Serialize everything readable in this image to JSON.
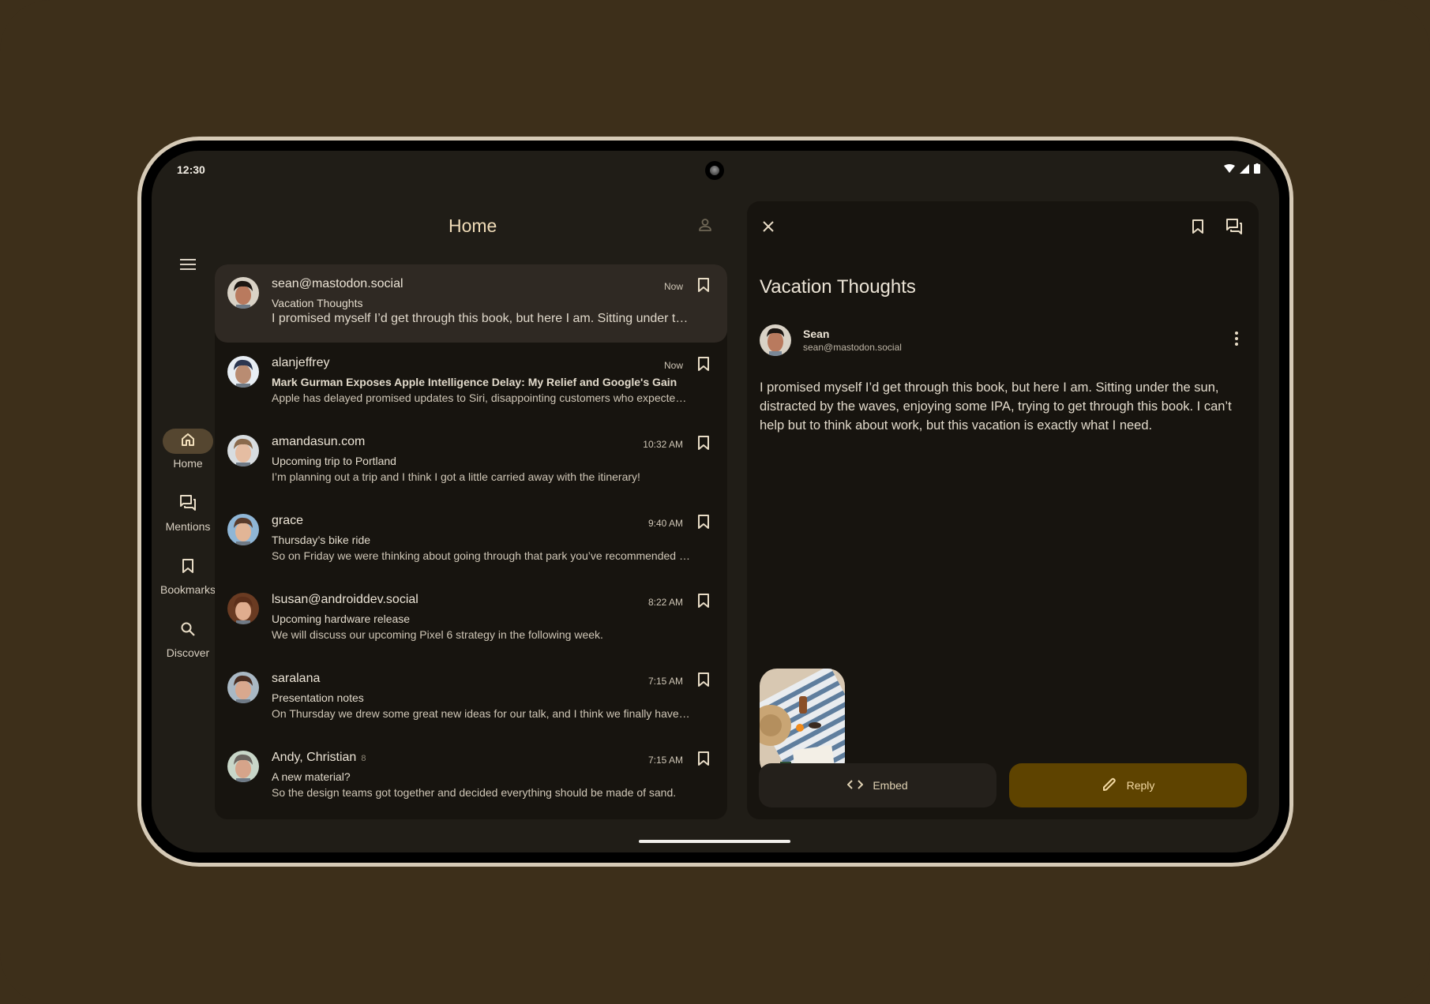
{
  "status_bar": {
    "time": "12:30",
    "icons": [
      "wifi-icon",
      "cellular-signal-icon",
      "battery-icon"
    ]
  },
  "nav_rail": {
    "menu_icon": "hamburger-menu-icon",
    "items": [
      {
        "label": "Home",
        "icon": "home-icon",
        "active": true
      },
      {
        "label": "Mentions",
        "icon": "chat-bubbles-icon",
        "active": false
      },
      {
        "label": "Bookmarks",
        "icon": "bookmark-icon",
        "active": false
      },
      {
        "label": "Discover",
        "icon": "search-icon",
        "active": false
      }
    ]
  },
  "list_header": {
    "title": "Home",
    "profile_icon": "person-icon"
  },
  "email_list": [
    {
      "sender": "sean@mastodon.social",
      "count": "",
      "time": "Now",
      "subject": "Vacation Thoughts",
      "preview": "I promised myself I’d get through this book, but here I am. Sitting under the sun, distracted by the waves, enjoying some IPA...",
      "selected": true,
      "bold_subject": false,
      "avatar_colors": [
        "#d9d2c6",
        "#1c1612",
        "#b97a5e"
      ]
    },
    {
      "sender": "alanjeffrey",
      "count": "",
      "time": "Now",
      "subject": "Mark Gurman Exposes Apple Intelligence Delay: My Relief and Google's Gain",
      "preview": "Apple has delayed promised updates to Siri, disappointing customers who expected them sooner.",
      "selected": false,
      "bold_subject": true,
      "avatar_colors": [
        "#e8eef4",
        "#2b3650",
        "#b98c72"
      ]
    },
    {
      "sender": "amandasun.com",
      "count": "",
      "time": "10:32 AM",
      "subject": "Upcoming trip to Portland",
      "preview": "I’m planning out a trip and I think I got a little carried away with the itinerary!",
      "selected": false,
      "bold_subject": false,
      "avatar_colors": [
        "#d8dde0",
        "#8a6a4c",
        "#e5bda2"
      ]
    },
    {
      "sender": "grace",
      "count": "",
      "time": "9:40 AM",
      "subject": "Thursday’s bike ride",
      "preview": "So on Friday we were thinking about going through that park you’ve recommended before.",
      "selected": false,
      "bold_subject": false,
      "avatar_colors": [
        "#8fb6d6",
        "#5a3b2a",
        "#e2b596"
      ]
    },
    {
      "sender": "lsusan@androiddev.social",
      "count": "",
      "time": "8:22 AM",
      "subject": "Upcoming hardware release",
      "preview": "We will discuss our upcoming Pixel 6 strategy in the following week.",
      "selected": false,
      "bold_subject": false,
      "avatar_colors": [
        "#6a3b22",
        "#5c2f1a",
        "#e0ad8e"
      ]
    },
    {
      "sender": "saralana",
      "count": "",
      "time": "7:15 AM",
      "subject": "Presentation notes",
      "preview": "On Thursday we drew some great new ideas for our talk, and I think we finally have it.",
      "selected": false,
      "bold_subject": false,
      "avatar_colors": [
        "#a9b8c4",
        "#4a2e22",
        "#d9a88e"
      ]
    },
    {
      "sender": "Andy, Christian",
      "count": "8",
      "time": "7:15 AM",
      "subject": "A new material?",
      "preview": "So the design teams got together and decided everything should be made of sand.",
      "selected": false,
      "bold_subject": false,
      "avatar_colors": [
        "#c8d6c8",
        "#6b6560",
        "#d6a48a"
      ]
    }
  ],
  "detail": {
    "close_icon": "close-icon",
    "bookmark_icon": "bookmark-icon",
    "reply_all_icon": "chat-bubbles-icon",
    "title": "Vacation Thoughts",
    "sender_name": "Sean",
    "sender_email": "sean@mastodon.social",
    "more_icon": "more-vert-icon",
    "body": "I promised myself I’d get through this book, but here I am. Sitting under the sun, distracted by the waves, enjoying some IPA, trying to get through this book. I can’t help but to think about work, but this vacation is exactly what I need.",
    "attachment_alt": "Beach towel with hat, book and drink on sand",
    "embed_label": "Embed",
    "reply_label": "Reply"
  },
  "colors": {
    "accent": "#5e4300",
    "accent_text": "#f3d9a3",
    "nav_active": "#554630",
    "background": "#3d2f1a"
  }
}
